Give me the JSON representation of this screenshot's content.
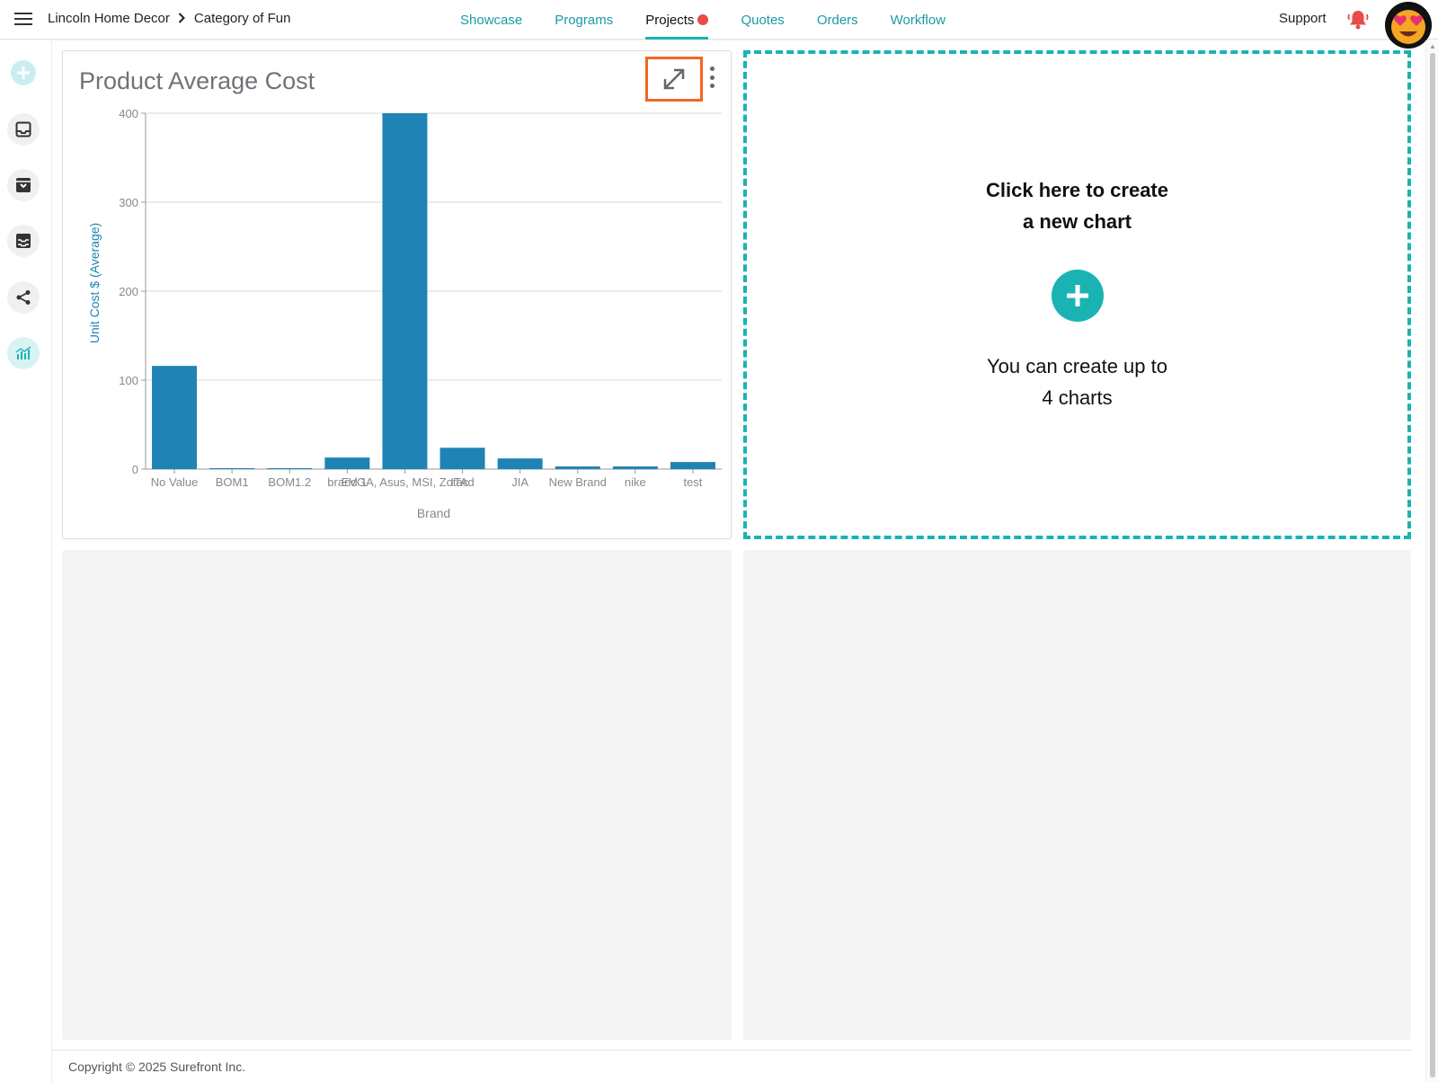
{
  "header": {
    "breadcrumb": [
      "Lincoln Home Decor",
      "Category of Fun"
    ],
    "nav": [
      {
        "label": "Showcase",
        "active": false
      },
      {
        "label": "Programs",
        "active": false
      },
      {
        "label": "Projects",
        "active": true,
        "badge": "red-dot"
      },
      {
        "label": "Quotes",
        "active": false
      },
      {
        "label": "Orders",
        "active": false
      },
      {
        "label": "Workflow",
        "active": false
      }
    ],
    "support_label": "Support",
    "icons": {
      "menu": "hamburger-icon",
      "notifications": "bell-icon",
      "avatar": "heart-eyes-emoji-avatar"
    }
  },
  "sidebar": {
    "items": [
      {
        "name": "add",
        "icon": "plus-circle-icon"
      },
      {
        "name": "inbox",
        "icon": "inbox-icon"
      },
      {
        "name": "archive",
        "icon": "archive-icon"
      },
      {
        "name": "trays",
        "icon": "trays-icon"
      },
      {
        "name": "share",
        "icon": "share-icon"
      },
      {
        "name": "analytics",
        "icon": "chart-icon",
        "active": true
      }
    ]
  },
  "chart_card": {
    "title": "Product Average Cost",
    "actions": [
      "expand-icon",
      "more-vertical-icon"
    ]
  },
  "chart_data": {
    "type": "bar",
    "title": "Product Average Cost",
    "xlabel": "Brand",
    "ylabel": "Unit Cost $ (Average)",
    "categories": [
      "No Value",
      "BOM1",
      "BOM1.2",
      "brand 1",
      "EVGA, Asus, MSI, Zotac",
      "ITAd",
      "JIA",
      "New Brand",
      "nike",
      "test"
    ],
    "values": [
      116,
      1,
      1,
      13,
      400,
      24,
      12,
      3,
      3,
      8
    ],
    "ylim": [
      0,
      400
    ],
    "yticks": [
      0,
      100,
      200,
      300,
      400
    ],
    "grid": true,
    "bar_color": "#1f83b5"
  },
  "create_chart": {
    "title_line1": "Click here to create",
    "title_line2": "a new chart",
    "sub_line1": "You can create up to",
    "sub_line2": "4 charts",
    "accent": "#1ab3b3"
  },
  "footer": {
    "copyright": "Copyright © 2025 Surefront Inc."
  },
  "colors": {
    "accent": "#1ab3b3",
    "link": "#1a9aa5",
    "alert": "#e94b4b",
    "highlight": "#f26522"
  }
}
